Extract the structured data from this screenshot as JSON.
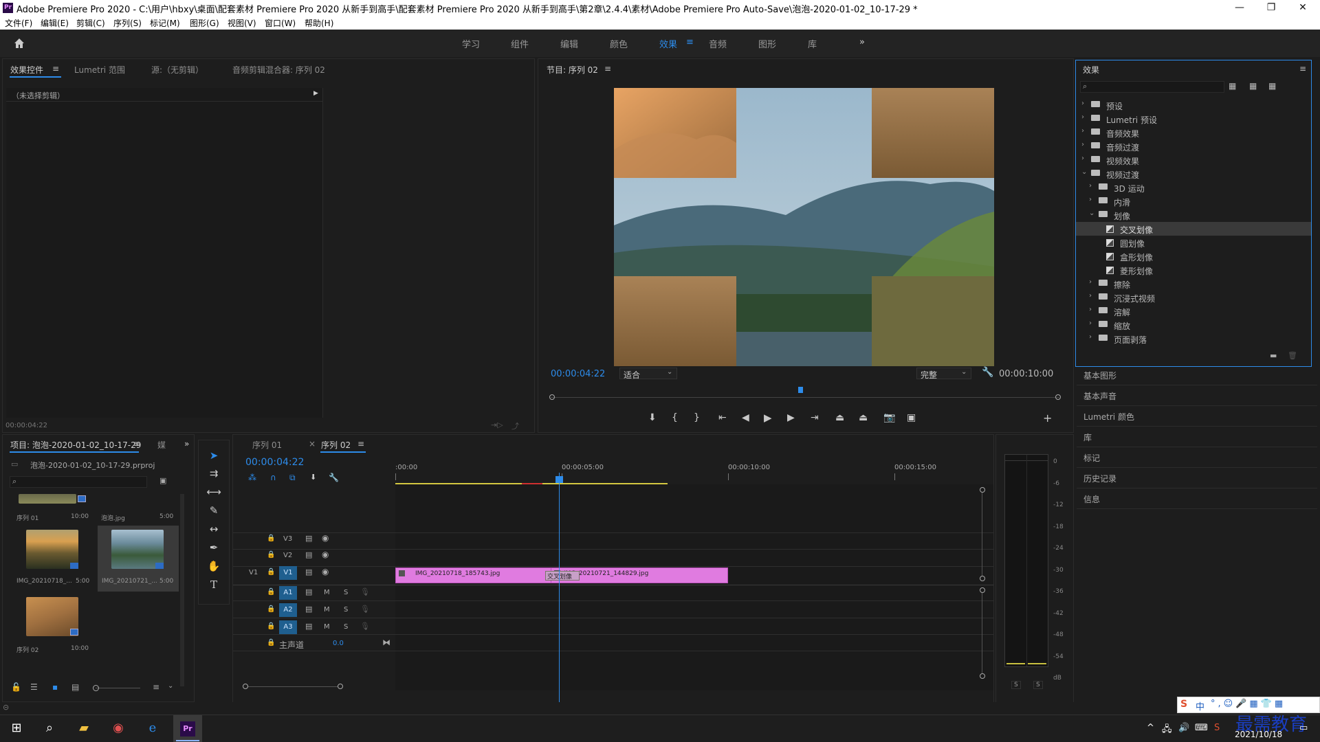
{
  "titlebar": {
    "title": "Adobe Premiere Pro 2020 - C:\\用户\\hbxy\\桌面\\配套素材 Premiere Pro 2020 从新手到高手\\配套素材 Premiere Pro 2020 从新手到高手\\第2章\\2.4.4\\素材\\Adobe Premiere Pro Auto-Save\\泡泡-2020-01-02_10-17-29 *",
    "app_icon": "Pr",
    "minimize": "—",
    "maximize": "❐",
    "close": "✕"
  },
  "menu": [
    "文件(F)",
    "编辑(E)",
    "剪辑(C)",
    "序列(S)",
    "标记(M)",
    "图形(G)",
    "视图(V)",
    "窗口(W)",
    "帮助(H)"
  ],
  "workspaces": {
    "items": [
      "学习",
      "组件",
      "编辑",
      "颜色",
      "效果",
      "音频",
      "图形",
      "库"
    ],
    "active": "效果",
    "more": "»"
  },
  "effect_controls": {
    "tabs": [
      "效果控件",
      "Lumetri 范围",
      "源:（无剪辑）",
      "音频剪辑混合器: 序列 02"
    ],
    "no_clip": "（未选择剪辑）",
    "timecode": "00:00:04:22"
  },
  "program": {
    "title": "节目: 序列 02",
    "timecode": "00:00:04:22",
    "fit": "适合",
    "quality": "完整",
    "duration": "00:00:10:00"
  },
  "effects": {
    "title": "效果",
    "search_placeholder": "",
    "items": [
      {
        "label": "预设",
        "level": 0,
        "kind": "bin",
        "open": false
      },
      {
        "label": "Lumetri 预设",
        "level": 0,
        "kind": "bin",
        "open": false
      },
      {
        "label": "音频效果",
        "level": 0,
        "kind": "folder",
        "open": false
      },
      {
        "label": "音频过渡",
        "level": 0,
        "kind": "folder",
        "open": false
      },
      {
        "label": "视频效果",
        "level": 0,
        "kind": "folder",
        "open": false
      },
      {
        "label": "视频过渡",
        "level": 0,
        "kind": "folder",
        "open": true
      },
      {
        "label": "3D 运动",
        "level": 1,
        "kind": "folder",
        "open": false
      },
      {
        "label": "内滑",
        "level": 1,
        "kind": "folder",
        "open": false
      },
      {
        "label": "划像",
        "level": 1,
        "kind": "folder",
        "open": true
      },
      {
        "label": "交叉划像",
        "level": 2,
        "kind": "preset",
        "selected": true
      },
      {
        "label": "圆划像",
        "level": 2,
        "kind": "preset"
      },
      {
        "label": "盒形划像",
        "level": 2,
        "kind": "preset"
      },
      {
        "label": "菱形划像",
        "level": 2,
        "kind": "preset"
      },
      {
        "label": "擦除",
        "level": 1,
        "kind": "folder",
        "open": false
      },
      {
        "label": "沉浸式视频",
        "level": 1,
        "kind": "folder",
        "open": false
      },
      {
        "label": "溶解",
        "level": 1,
        "kind": "folder",
        "open": false
      },
      {
        "label": "缩放",
        "level": 1,
        "kind": "folder",
        "open": false
      },
      {
        "label": "页面剥落",
        "level": 1,
        "kind": "folder",
        "open": false
      }
    ],
    "panels": [
      "基本图形",
      "基本声音",
      "Lumetri 颜色",
      "库",
      "标记",
      "历史记录",
      "信息"
    ]
  },
  "project": {
    "tab": "项目: 泡泡-2020-01-02_10-17-29",
    "tab2": "媒",
    "file": "泡泡-2020-01-02_10-17-29.prproj",
    "items": [
      {
        "name": "序列 01",
        "dur": "10:00"
      },
      {
        "name": "泡泡.jpg",
        "dur": "5:00"
      },
      {
        "name": "IMG_20210718_...",
        "dur": "5:00"
      },
      {
        "name": "IMG_20210721_...",
        "dur": "5:00"
      },
      {
        "name": "序列 02",
        "dur": "10:00"
      }
    ]
  },
  "timeline": {
    "tabs": [
      "序列 01",
      "序列 02"
    ],
    "close": "×",
    "timecode": "00:00:04:22",
    "ruler": [
      ":00:00",
      "00:00:05:00",
      "00:00:10:00",
      "00:00:15:00"
    ],
    "video_tracks": [
      "V3",
      "V2",
      "V1"
    ],
    "audio_tracks": [
      "A1",
      "A2",
      "A3"
    ],
    "v1_label": "V1",
    "master": "主声道",
    "master_val": "0.0",
    "clips": [
      "IMG_20210718_185743.jpg",
      "IMG_20210721_144829.jpg"
    ],
    "transition": "交叉划像",
    "m": "M",
    "s": "S"
  },
  "meter": {
    "scale": [
      "0",
      "-6",
      "-12",
      "-18",
      "-24",
      "-30",
      "-36",
      "-42",
      "-48",
      "-54",
      "dB"
    ],
    "solo": [
      "S",
      "S"
    ]
  },
  "tray": {
    "date": "2021/10/18",
    "ime": "中",
    "watermark": "最需教育"
  },
  "colors": {
    "accent": "#2d8ceb",
    "clip": "#e07be0",
    "playhead": "#2d8ceb",
    "track_btn": "#1f5f8f"
  }
}
